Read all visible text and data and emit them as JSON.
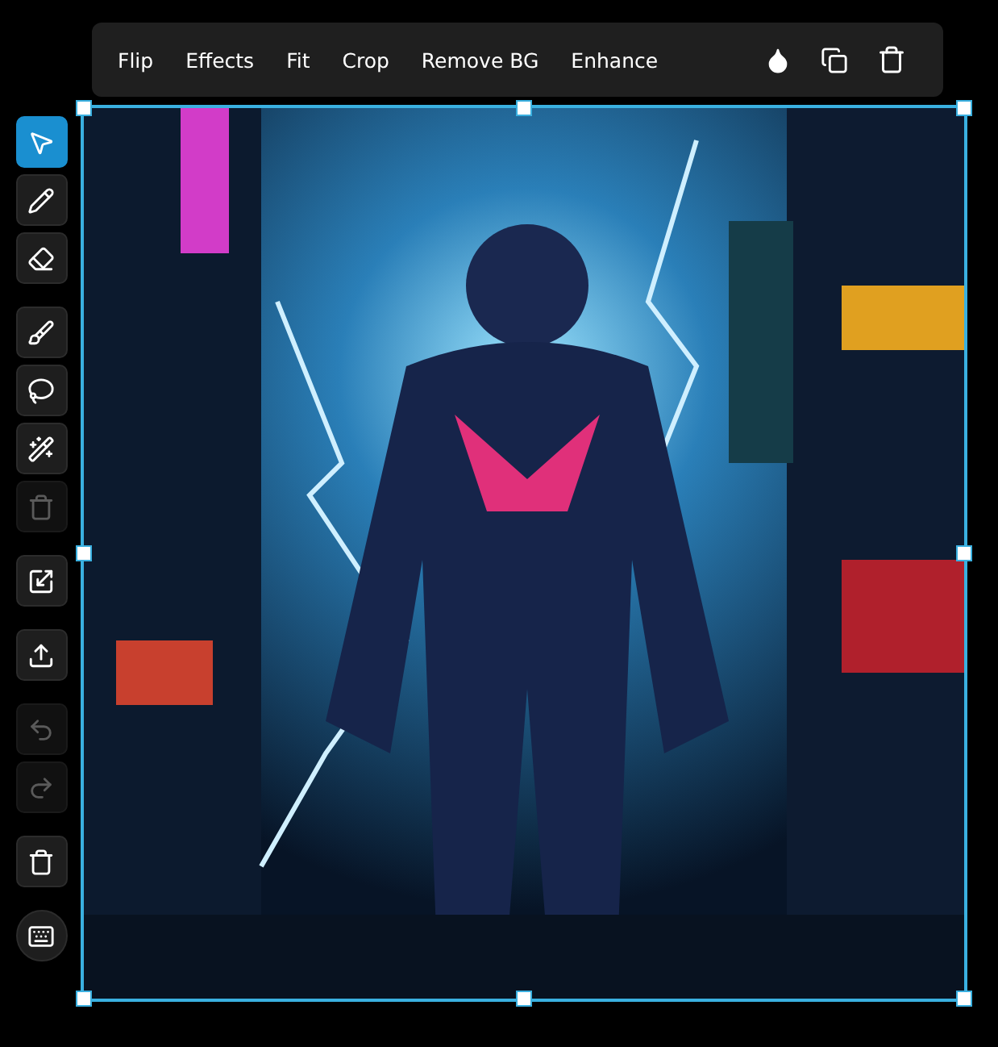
{
  "toolbar": {
    "actions": [
      "Flip",
      "Effects",
      "Fit",
      "Crop",
      "Remove BG",
      "Enhance"
    ],
    "icon_buttons": [
      {
        "kind": "opacity"
      },
      {
        "kind": "duplicate"
      },
      {
        "kind": "delete"
      }
    ]
  },
  "tool_groups": [
    [
      {
        "kind": "select",
        "selected": true,
        "disabled": false
      },
      {
        "kind": "pen",
        "selected": false,
        "disabled": false
      },
      {
        "kind": "eraser",
        "selected": false,
        "disabled": false
      }
    ],
    [
      {
        "kind": "brush",
        "selected": false,
        "disabled": false
      },
      {
        "kind": "lasso",
        "selected": false,
        "disabled": false
      },
      {
        "kind": "magic",
        "selected": false,
        "disabled": false
      },
      {
        "kind": "delete",
        "selected": false,
        "disabled": true
      }
    ],
    [
      {
        "kind": "resize",
        "selected": false,
        "disabled": false
      }
    ],
    [
      {
        "kind": "export",
        "selected": false,
        "disabled": false
      }
    ],
    [
      {
        "kind": "undo",
        "selected": false,
        "disabled": true
      },
      {
        "kind": "redo",
        "selected": false,
        "disabled": true
      }
    ],
    [
      {
        "kind": "delete",
        "selected": false,
        "disabled": false
      }
    ],
    [
      {
        "kind": "keyboard",
        "selected": false,
        "disabled": false
      }
    ]
  ],
  "canvas": {
    "selected": true
  }
}
